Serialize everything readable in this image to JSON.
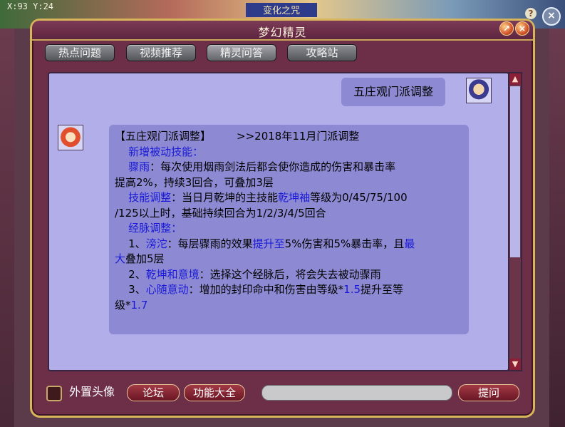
{
  "background": {
    "hud_text": "X:93 Y:24",
    "ghost_title": "变化之咒",
    "help_icon": "?",
    "close_icon": "×"
  },
  "window": {
    "title": "梦幻精灵",
    "min_icon": "↗",
    "close_icon": "×",
    "tabs": [
      {
        "label": "热点问题",
        "active": false
      },
      {
        "label": "视频推荐",
        "active": false
      },
      {
        "label": "精灵问答",
        "active": true
      },
      {
        "label": "攻略站",
        "active": false
      }
    ]
  },
  "chat": {
    "user_message": "五庄观门派调整",
    "npc": {
      "header_title": "【五庄观门派调整】",
      "header_sub": ">>2018年11月门派调整",
      "l2": "新增被动技能：",
      "l3a": "骤雨",
      "l3b": "：每次使用烟雨剑法后都会使你造成的伤害和暴击率",
      "l4": "提高2%，持续3回合，可叠加3层",
      "l5a": "技能调整",
      "l5b": "：当日月乾坤的主技能",
      "l5c": "乾坤袖",
      "l5d": "等级为0/45/75/100",
      "l6": "/125以上时，基础持续回合为1/2/3/4/5回合",
      "l7": "经脉调整：",
      "l8a": "1、",
      "l8b": "滂沱",
      "l8c": "：每层骤雨的效果",
      "l8d": "提升至",
      "l8e": "5%伤害和5%暴击率，且",
      "l8f": "最",
      "l9a": "大",
      "l9b": "叠加5层",
      "l10a": "2、",
      "l10b": "乾坤和意境",
      "l10c": "：选择这个经脉后，将会失去被动骤雨",
      "l11a": "3、",
      "l11b": "心随意动",
      "l11c": "：增加的封印命中和伤害由等级*",
      "l11d": "1.5",
      "l11e": "提升至等",
      "l12a": "级*",
      "l12b": "1.7"
    }
  },
  "footer": {
    "checkbox_label": "外置头像",
    "forum_button": "论坛",
    "functions_button": "功能大全",
    "ask_button": "提问",
    "input_value": ""
  },
  "colors": {
    "window": "#6c2f47",
    "chat_bg": "#b1aeea",
    "bubble": "#8d8ad3",
    "accent_blue": "#1a1ad6",
    "border_gold": "#d8b45a"
  }
}
